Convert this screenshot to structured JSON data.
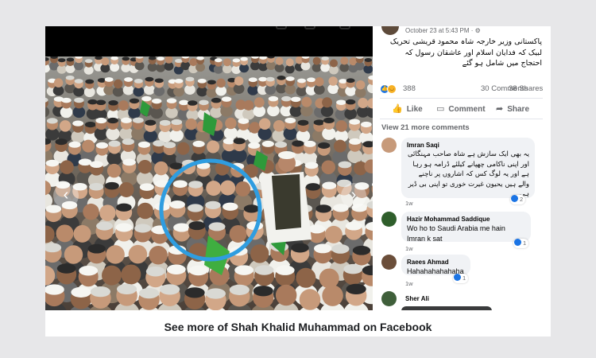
{
  "post": {
    "timestamp": "October 23 at 5:43 PM · ⚙",
    "caption": "پاکستانی وزیر خارجہ شاہ محمود قریشی تحریک لبیک کہ فدایان اسلام اور عاشقان رسول کہ احتجاج میں شامل ہو گئے",
    "reaction_count": "388",
    "comments_count": "30 Comments",
    "shares_count": "38 Shares",
    "actions": {
      "like": "Like",
      "comment": "Comment",
      "share": "Share"
    },
    "view_more_comments": "View 21 more comments"
  },
  "comments": [
    {
      "author": "Imran Saqi",
      "text": "یہ بھی ایک سازش ہے شاہ صاحب مہنگائی اور اپنی ناکامی چھپانے کیلئے ڈرامہ ہو رہا ہے اور یہ لوگ کس کہ اشاروں پر ناچنے والے ہیں یحیون غیرت خوری تو اپنی بی ڈیر ہی",
      "time": "1w",
      "reaction_count": "2"
    },
    {
      "author": "Hazir Mohammad Saddique",
      "text": "Wo ho to Saudi Arabia me hain Imran k sat",
      "time": "1w",
      "reaction_count": "1"
    },
    {
      "author": "Raees Ahmad",
      "text": "Hahahahahahaha",
      "time": "1w",
      "reaction_count": "1"
    },
    {
      "author": "Sher Ali",
      "text": "",
      "time": "",
      "reaction_count": ""
    }
  ],
  "cta": {
    "text": "See more of Shah Khalid Muhammad on Facebook"
  },
  "icons": {
    "like_reaction": "like-reaction-icon",
    "haha_reaction": "haha-reaction-icon",
    "like_action": "thumbs-up-icon",
    "comment_action": "comment-bubble-icon",
    "share_action": "share-arrow-icon",
    "prev": "chevron-left-icon",
    "next": "chevron-right-icon"
  },
  "colors": {
    "facebook_blue": "#1b74e4",
    "highlight_circle": "#2f9de0",
    "flag_green": "#2e9a3a"
  }
}
